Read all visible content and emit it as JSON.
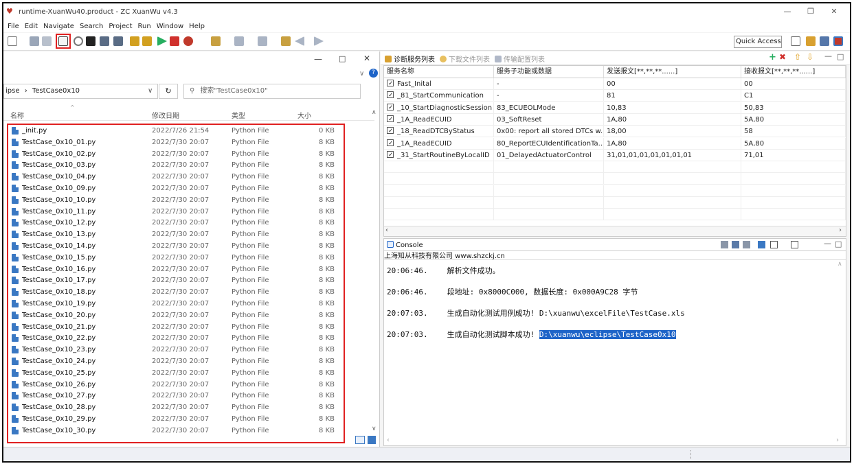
{
  "window": {
    "title": "runtime-XuanWu40.product - ZC XuanWu v4.3"
  },
  "menu": [
    "File",
    "Edit",
    "Navigate",
    "Search",
    "Project",
    "Run",
    "Window",
    "Help"
  ],
  "toolbar": {
    "quick_access": "Quick Access"
  },
  "explorer": {
    "breadcrumb_prefix": "ipse",
    "breadcrumb_sep": "›",
    "breadcrumb_folder": "TestCase0x10",
    "search_placeholder": "搜索\"TestCase0x10\"",
    "columns": {
      "name": "名称",
      "modified": "修改日期",
      "type": "类型",
      "size": "大小"
    },
    "files": [
      {
        "name": "_init.py",
        "date": "2022/7/26 21:54",
        "type": "Python File",
        "size": "0 KB"
      },
      {
        "name": "TestCase_0x10_01.py",
        "date": "2022/7/30 20:07",
        "type": "Python File",
        "size": "8 KB"
      },
      {
        "name": "TestCase_0x10_02.py",
        "date": "2022/7/30 20:07",
        "type": "Python File",
        "size": "8 KB"
      },
      {
        "name": "TestCase_0x10_03.py",
        "date": "2022/7/30 20:07",
        "type": "Python File",
        "size": "8 KB"
      },
      {
        "name": "TestCase_0x10_04.py",
        "date": "2022/7/30 20:07",
        "type": "Python File",
        "size": "8 KB"
      },
      {
        "name": "TestCase_0x10_09.py",
        "date": "2022/7/30 20:07",
        "type": "Python File",
        "size": "8 KB"
      },
      {
        "name": "TestCase_0x10_10.py",
        "date": "2022/7/30 20:07",
        "type": "Python File",
        "size": "8 KB"
      },
      {
        "name": "TestCase_0x10_11.py",
        "date": "2022/7/30 20:07",
        "type": "Python File",
        "size": "8 KB"
      },
      {
        "name": "TestCase_0x10_12.py",
        "date": "2022/7/30 20:07",
        "type": "Python File",
        "size": "8 KB"
      },
      {
        "name": "TestCase_0x10_13.py",
        "date": "2022/7/30 20:07",
        "type": "Python File",
        "size": "8 KB"
      },
      {
        "name": "TestCase_0x10_14.py",
        "date": "2022/7/30 20:07",
        "type": "Python File",
        "size": "8 KB"
      },
      {
        "name": "TestCase_0x10_15.py",
        "date": "2022/7/30 20:07",
        "type": "Python File",
        "size": "8 KB"
      },
      {
        "name": "TestCase_0x10_16.py",
        "date": "2022/7/30 20:07",
        "type": "Python File",
        "size": "8 KB"
      },
      {
        "name": "TestCase_0x10_17.py",
        "date": "2022/7/30 20:07",
        "type": "Python File",
        "size": "8 KB"
      },
      {
        "name": "TestCase_0x10_18.py",
        "date": "2022/7/30 20:07",
        "type": "Python File",
        "size": "8 KB"
      },
      {
        "name": "TestCase_0x10_19.py",
        "date": "2022/7/30 20:07",
        "type": "Python File",
        "size": "8 KB"
      },
      {
        "name": "TestCase_0x10_20.py",
        "date": "2022/7/30 20:07",
        "type": "Python File",
        "size": "8 KB"
      },
      {
        "name": "TestCase_0x10_21.py",
        "date": "2022/7/30 20:07",
        "type": "Python File",
        "size": "8 KB"
      },
      {
        "name": "TestCase_0x10_22.py",
        "date": "2022/7/30 20:07",
        "type": "Python File",
        "size": "8 KB"
      },
      {
        "name": "TestCase_0x10_23.py",
        "date": "2022/7/30 20:07",
        "type": "Python File",
        "size": "8 KB"
      },
      {
        "name": "TestCase_0x10_24.py",
        "date": "2022/7/30 20:07",
        "type": "Python File",
        "size": "8 KB"
      },
      {
        "name": "TestCase_0x10_25.py",
        "date": "2022/7/30 20:07",
        "type": "Python File",
        "size": "8 KB"
      },
      {
        "name": "TestCase_0x10_26.py",
        "date": "2022/7/30 20:07",
        "type": "Python File",
        "size": "8 KB"
      },
      {
        "name": "TestCase_0x10_27.py",
        "date": "2022/7/30 20:07",
        "type": "Python File",
        "size": "8 KB"
      },
      {
        "name": "TestCase_0x10_28.py",
        "date": "2022/7/30 20:07",
        "type": "Python File",
        "size": "8 KB"
      },
      {
        "name": "TestCase_0x10_29.py",
        "date": "2022/7/30 20:07",
        "type": "Python File",
        "size": "8 KB"
      },
      {
        "name": "TestCase_0x10_30.py",
        "date": "2022/7/30 20:07",
        "type": "Python File",
        "size": "8 KB"
      }
    ]
  },
  "services": {
    "tabs": [
      "诊断服务列表",
      "下载文件列表",
      "传输配置列表"
    ],
    "columns": [
      "服务名称",
      "服务子功能或数据",
      "发送报文[**,**,**......]",
      "接收报文[**,**,**......]"
    ],
    "rows": [
      [
        "Fast_Inital",
        "-",
        "00",
        "00"
      ],
      [
        "_81_StartCommunication",
        "-",
        "81",
        "C1"
      ],
      [
        "_10_StartDiagnosticSession",
        "83_ECUEOLMode",
        "10,83",
        "50,83"
      ],
      [
        "_1A_ReadECUID",
        "03_SoftReset",
        "1A,80",
        "5A,80"
      ],
      [
        "_18_ReadDTCByStatus",
        "0x00: report all stored DTCs w...",
        "18,00",
        "58"
      ],
      [
        "_1A_ReadECUID",
        "80_ReportECUIdentificationTa...",
        "1A,80",
        "5A,80"
      ],
      [
        "_31_StartRoutineByLocalID",
        "01_DelayedActuatorControl",
        "31,01,01,01,01,01,01,01",
        "71,01"
      ]
    ]
  },
  "console": {
    "title": "Console",
    "company": "上海知从科技有限公司    www.shzckj.cn",
    "lines": [
      {
        "time": "20:06:46.",
        "msg": "解析文件成功。",
        "sel": ""
      },
      {
        "time": "20:06:46.",
        "msg": "段地址:  0x8000C000, 数据长度: 0x000A9C28 字节",
        "sel": ""
      },
      {
        "time": "20:07:03.",
        "msg": "生成自动化测试用例成功! D:\\xuanwu\\excelFile\\TestCase.xls",
        "sel": ""
      },
      {
        "time": "20:07:03.",
        "msg": "生成自动化测试脚本成功! ",
        "sel": "D:\\xuanwu\\eclipse\\TestCase0x10"
      }
    ]
  },
  "colors": {
    "highlight": "#e02020",
    "selection": "#1e64c8",
    "file_icon": "#3a78c3"
  }
}
